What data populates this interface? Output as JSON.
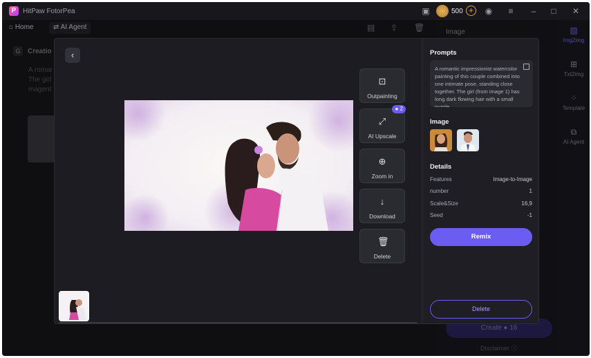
{
  "app": {
    "title": "HitPaw FotorPea",
    "credits": "500"
  },
  "nav": {
    "home_label": "Home",
    "agent_label": "AI Agent"
  },
  "background": {
    "creation_label": "Creatio",
    "prompt_lines": [
      "A romar",
      "The girl",
      "magent"
    ],
    "right_panel_label": "Image",
    "create_label": "Create",
    "create_cost": "16",
    "disclaimer_label": "Disclaimer"
  },
  "sidebar": {
    "items": [
      {
        "label": "Img2img",
        "icon": "img2img-icon"
      },
      {
        "label": "Txt2img",
        "icon": "txt2img-icon"
      },
      {
        "label": "Template",
        "icon": "template-icon"
      },
      {
        "label": "AI Agent",
        "icon": "ai-agent-icon"
      }
    ]
  },
  "tools": {
    "outpainting": "Outpainting",
    "upscale": "AI Upscale",
    "upscale_badge": "2",
    "zoom": "Zoom in",
    "download": "Download",
    "delete": "Delete"
  },
  "details_panel": {
    "prompts_title": "Prompts",
    "prompt_text": "A romantic impressionist watercolor painting of this couple combined into one intimate pose, standing close together. The girl (from image 1) has long dark flowing hair with a small purple",
    "image_title": "Image",
    "details_title": "Details",
    "rows": [
      {
        "label": "Features",
        "value": "Image-to-Image"
      },
      {
        "label": "number",
        "value": "1"
      },
      {
        "label": "Scale&Size",
        "value": "16,9"
      },
      {
        "label": "Seed",
        "value": "-1"
      }
    ],
    "remix_label": "Remix",
    "delete_label": "Delete"
  },
  "colors": {
    "accent": "#6b5cf2",
    "background": "#17171c",
    "panel": "#1e1e24"
  }
}
